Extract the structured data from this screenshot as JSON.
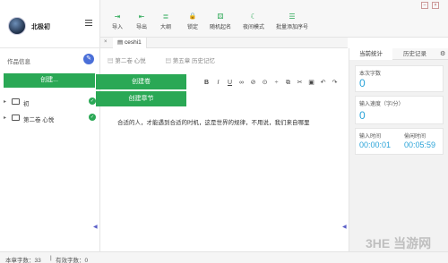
{
  "profile": {
    "username": "北极初"
  },
  "sidebar": {
    "works_title": "作品信息",
    "edit_icon": "edit-icon",
    "create_label": "创建...",
    "tree": [
      {
        "label": "初"
      },
      {
        "label": "第二卷 心悦"
      }
    ]
  },
  "toolbar": {
    "items": [
      {
        "label": "导入",
        "icon": "import-icon",
        "glyph": "⇥"
      },
      {
        "label": "导出",
        "icon": "export-icon",
        "glyph": "⇤"
      },
      {
        "label": "大纲",
        "icon": "outline-icon",
        "glyph": "≣"
      },
      {
        "label": "锁定",
        "icon": "lock-icon",
        "glyph": "🔒"
      },
      {
        "label": "随机起名",
        "icon": "random-name-icon",
        "glyph": "⚄"
      },
      {
        "label": "夜间模式",
        "icon": "moon-icon",
        "glyph": "☾"
      },
      {
        "label": "批量添加序号",
        "icon": "list-number-icon",
        "glyph": "☰"
      }
    ]
  },
  "tabs": [
    {
      "label": "ceshi1"
    }
  ],
  "breadcrumb": {
    "volume": "第二卷 心悦",
    "chapter": "第五章 历史记忆"
  },
  "dropdown": {
    "create_volume": "创建卷",
    "create_chapter": "创建章节"
  },
  "format_toolbar": [
    "B",
    "I",
    "U",
    "∞",
    "⊘",
    "⊙",
    "÷",
    "⧉",
    "✂",
    "▣",
    "↶",
    "↷"
  ],
  "editor": {
    "text": "合适的人，才能遇到合适的时机，这是世界的规律，不用说，我们来自哪里"
  },
  "right_panel": {
    "tab_stats": "当前统计",
    "tab_history": "历史记录",
    "chapter_chars_label": "本次字数",
    "chapter_chars_value": "0",
    "speed_label": "输入速度（字/分）",
    "speed_value": "0",
    "input_time_label": "输入时间",
    "input_time_value": "00:00:01",
    "idle_time_label": "偷闲时间",
    "idle_time_value": "00:05:59"
  },
  "statusbar": {
    "chapter_count": "本章字数：33",
    "valid_count": "有效字数：0"
  },
  "watermark": "3HE 当游网",
  "colors": {
    "accent_green": "#2aa855",
    "value_blue": "#2aa3d8"
  }
}
